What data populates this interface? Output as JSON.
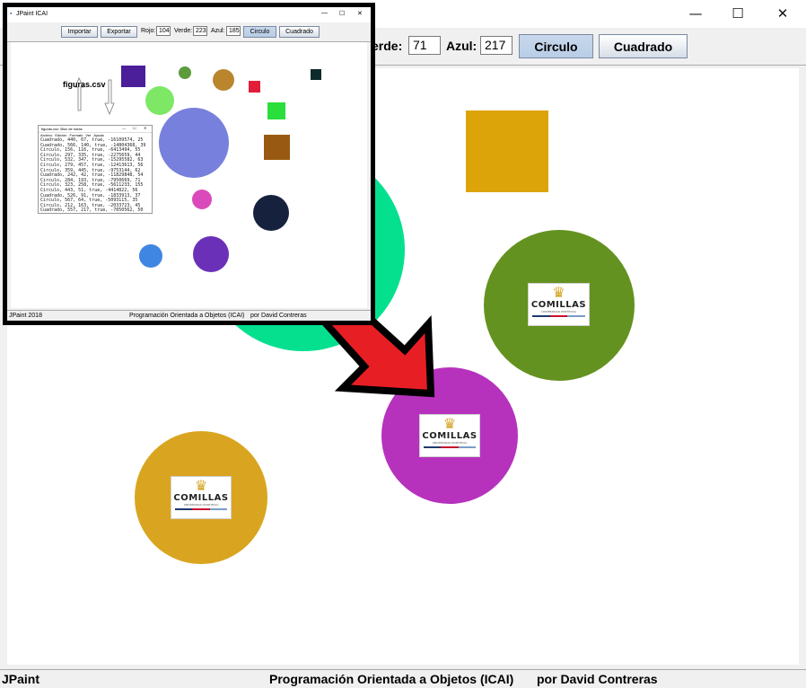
{
  "window": {
    "minimize_glyph": "—",
    "maximize_glyph": "☐",
    "close_glyph": "✕"
  },
  "toolbar": {
    "green_label": "erde:",
    "green_value": "71",
    "blue_label": "Azul:",
    "blue_value": "217",
    "circle_button": "Circulo",
    "square_button": "Cuadrado"
  },
  "status": {
    "app_name": "JPaint",
    "course": "Programación Orientada a Objetos (ICAI)",
    "author": "por David Contreras"
  },
  "canvas": {
    "shapes": [
      {
        "type": "circle",
        "color": "#05e08f"
      },
      {
        "type": "square",
        "color": "#dda40a"
      },
      {
        "type": "circle",
        "color": "#649220",
        "logo": true
      },
      {
        "type": "circle",
        "color": "#b632bd",
        "logo": true
      },
      {
        "type": "circle",
        "color": "#d9a520",
        "logo": true
      }
    ],
    "arrow_color": "#e81e25",
    "logo": {
      "name": "COMILLAS",
      "subtitle": "UNIVERSIDAD PONTIFICIA",
      "stripe_colors": [
        "#1f3a6e",
        "#c8102e",
        "#7a9cc8"
      ]
    }
  },
  "embedded": {
    "title": "JPaint ICAI",
    "buttons": {
      "import": "Importar",
      "export": "Exportar",
      "circle": "Circulo",
      "square": "Cuadrado"
    },
    "labels": {
      "red": "Rojo:",
      "green": "Verde:",
      "blue": "Azul:"
    },
    "values": {
      "red": "104",
      "green": "223",
      "blue": "185"
    },
    "file_label": "figuras.csv",
    "notepad": {
      "title": "figuras.csv: Bloc de notas",
      "menu": [
        "Archivo",
        "Edición",
        "Formato",
        "Ver",
        "Ayuda"
      ],
      "lines": [
        "Cuadrado, 440, 67, true, -16109574, 25",
        "Cuadrado, 566, 140, true, -14804368, 39",
        "Circulo, 156, 116, true, -6413494, 55",
        "Circulo, 297, 335, true, -2275659, 44",
        "Circulo, 532, 347, true, -15295582, 63",
        "Circulo, 279, 457, true, -12413613, 56",
        "Circulo, 359, 445, true, -9753144, 62",
        "Cuadrado, 242, 42, true, -11829848, 54",
        "Circulo, 284, 193, true, -7950669, 71",
        "Circulo, 323, 258, true, -5611233, 155",
        "Circulo, 443, 51, true, -4414822, 56",
        "Cuadrado, 526, 91, true, -1833913, 37",
        "Circulo, 567, 64, true, -5093115, 35",
        "Circulo, 212, 163, true, -2033723, 45",
        "Cuadrado, 557, 217, true, -7050562, 50"
      ]
    },
    "status": {
      "app_name": "JPaint 2018",
      "course": "Programación Orientada a Objetos (ICAI)",
      "author": "por David Contreras"
    }
  }
}
